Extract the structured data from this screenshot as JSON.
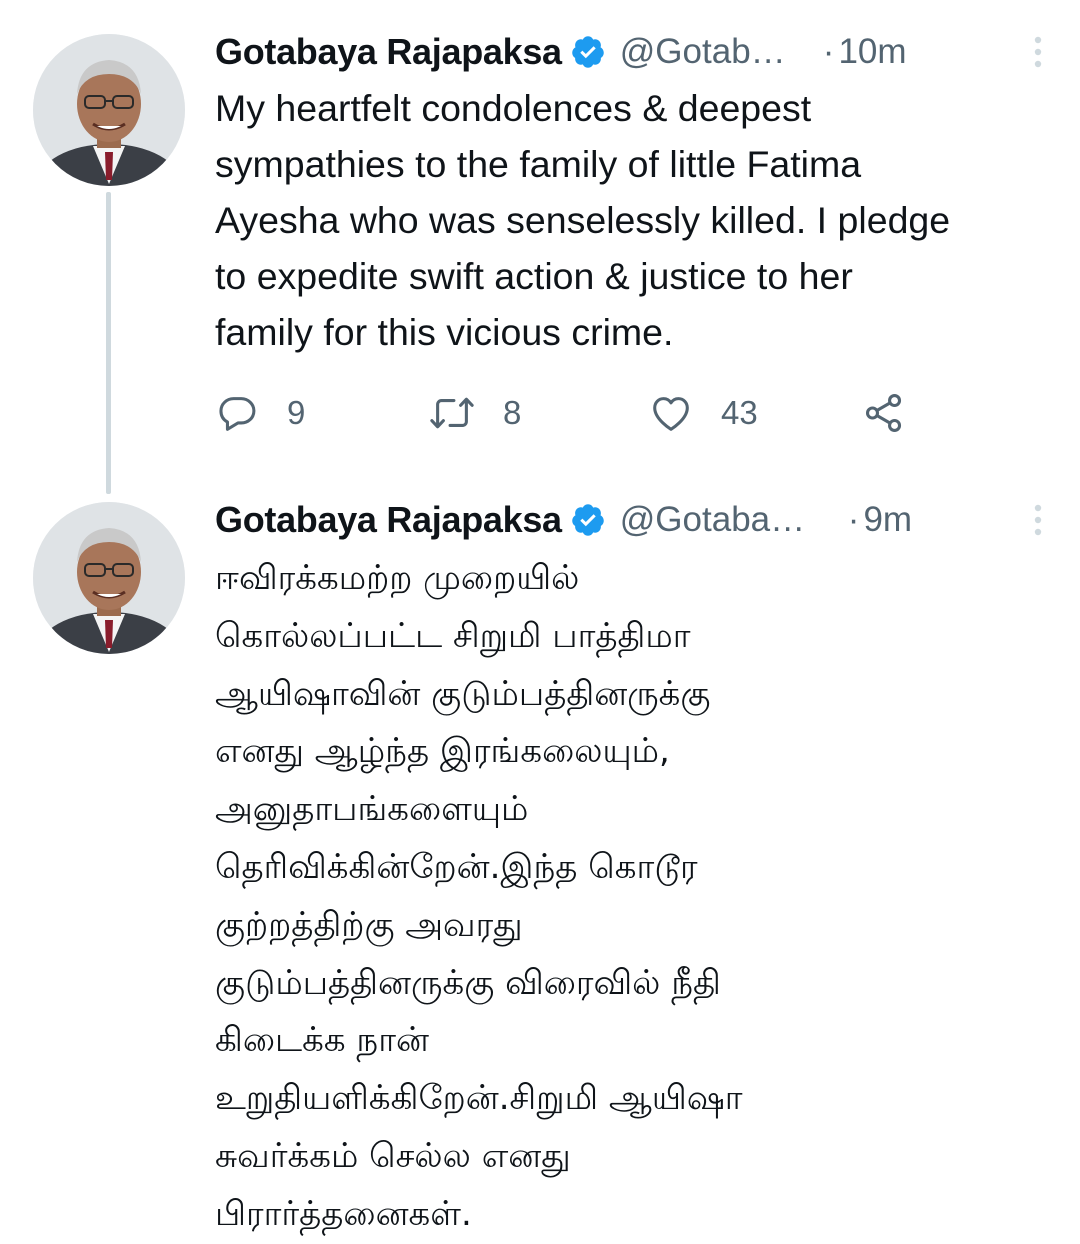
{
  "colors": {
    "text": "#0f1419",
    "secondary": "#536471",
    "verified": "#1d9bf0",
    "thread_line": "#cfd9de"
  },
  "tweets": [
    {
      "author_name": "Gotabaya Rajapaksa",
      "handle": "@Gotab…",
      "separator": "·",
      "time": "10m",
      "text": "My heartfelt condolences & deepest\nsympathies to the family of little Fatima\nAyesha who was senselessly killed. I pledge\nto expedite swift action & justice to her\nfamily for this vicious crime.",
      "reply_count": "9",
      "retweet_count": "8",
      "like_count": "43"
    },
    {
      "author_name": "Gotabaya Rajapaksa",
      "handle": "@Gotaba…",
      "separator": "·",
      "time": "9m",
      "text": "ஈவிரக்கமற்ற முறையில்\nகொல்லப்பட்ட சிறுமி பாத்திமா\nஆயிஷாவின் குடும்பத்தினருக்கு\nஎனது ஆழ்ந்த இரங்கலையும்,\nஅனுதாபங்களையும்\nதெரிவிக்கின்றேன்.இந்த கொடூர\nகுற்றத்திற்கு அவரது\nகுடும்பத்தினருக்கு விரைவில் நீதி\nகிடைக்க நான்\nஉறுதியளிக்கிறேன்.சிறுமி ஆயிஷா\nசுவர்க்கம் செல்ல எனது\nபிரார்த்தனைகள்."
    }
  ],
  "icons": {
    "verified": "verified-badge-icon",
    "more": "more-vertical-icon",
    "reply": "reply-icon",
    "retweet": "retweet-icon",
    "like": "heart-icon",
    "share": "share-icon"
  }
}
